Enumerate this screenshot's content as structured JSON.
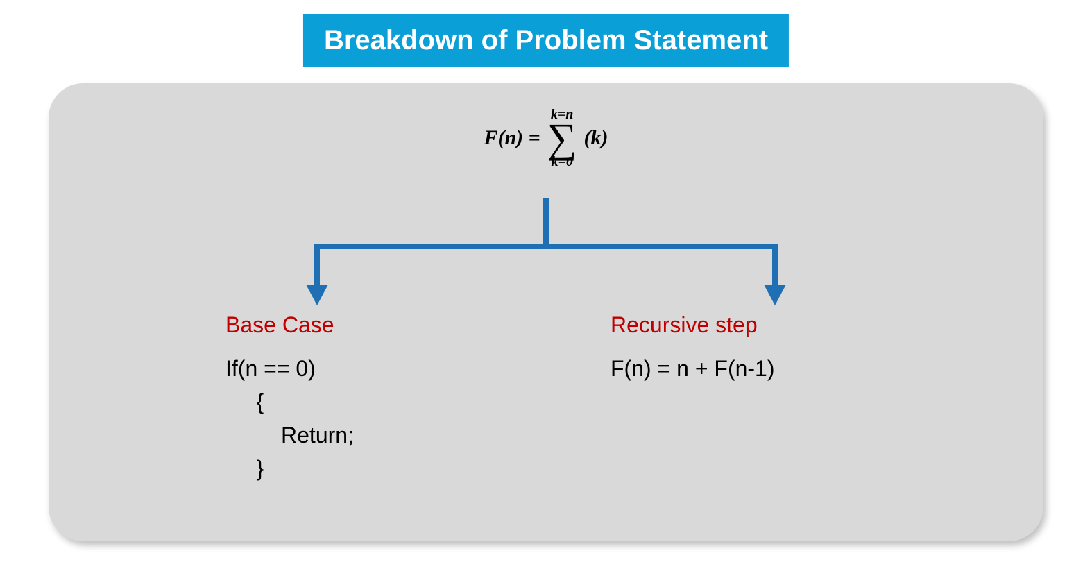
{
  "title": "Breakdown of Problem Statement",
  "formula": {
    "lhs": "F(n) =",
    "sum_upper": "k=n",
    "sum_lower": "k=0",
    "rhs": "(k)"
  },
  "left": {
    "heading": "Base Case",
    "body": "If(n == 0)\n     {\n         Return;\n     }"
  },
  "right": {
    "heading": "Recursive step",
    "body": "F(n) = n + F(n-1)"
  },
  "colors": {
    "accent": "#0b9fd8",
    "panel": "#d9d9d9",
    "heading_red": "#c00000",
    "connector": "#1f6fb5"
  }
}
